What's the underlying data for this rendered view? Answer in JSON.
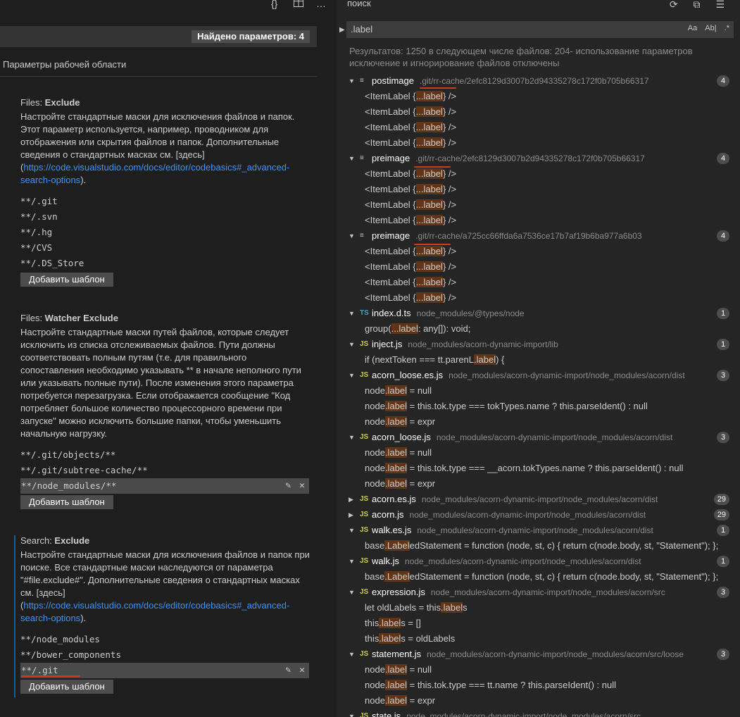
{
  "settings": {
    "topbar": {
      "braces_icon": "{}",
      "split_icon": "split-editor-icon",
      "more_icon": "…"
    },
    "found_badge": "Найдено параметров: 4",
    "section_title": "Параметры рабочей области",
    "files_exclude": {
      "category": "Files: ",
      "name": "Exclude",
      "desc_before": "Настройте стандартные маски для исключения файлов и папок. Этот параметр используется, например, проводником для отображения или скрытия файлов и папок. Дополнительные сведения о стандартных масках см. [здесь] (",
      "link": "https://code.visualstudio.com/docs/editor/codebasics#_advanced-search-options",
      "desc_after": ").",
      "patterns": [
        "**/.git",
        "**/.svn",
        "**/.hg",
        "**/CVS",
        "**/.DS_Store"
      ],
      "add_label": "Добавить шаблон"
    },
    "watcher_exclude": {
      "category": "Files: ",
      "name": "Watcher Exclude",
      "desc": "Настройте стандартные маски путей файлов, которые следует исключить из списка отслеживаемых файлов. Пути должны соответствовать полным путям (т.е. для правильного сопоставления необходимо указывать ** в начале неполного пути или указывать полные пути). После изменения этого параметра потребуется перезагрузка. Если отображается сообщение \"Код потребляет большое количество процессорного времени при запуске\" можно исключить большие папки, чтобы уменьшить начальную нагрузку.",
      "patterns": [
        "**/.git/objects/**",
        "**/.git/subtree-cache/**",
        "**/node_modules/**"
      ],
      "add_label": "Добавить шаблон"
    },
    "search_exclude": {
      "category": "Search: ",
      "name": "Exclude",
      "desc_before": "Настройте стандартные маски для исключения файлов и папок при поиске. Все стандартные маски наследуются от параметра \"#file.exclude#\". Дополнительные сведения о стандартных масках см. [здесь] (",
      "link": "https://code.visualstudio.com/docs/editor/codebasics#_advanced-search-options",
      "desc_after": ").",
      "patterns": [
        "**/node_modules",
        "**/bower_components",
        "**/.git"
      ],
      "add_label": "Добавить шаблон"
    },
    "edit_icon": "✎",
    "remove_icon": "✕"
  },
  "search": {
    "title": "поиск",
    "actions": {
      "refresh": "refresh-icon",
      "collapse": "collapse-all-icon",
      "clear": "clear-results-icon"
    },
    "query": ".label",
    "options": [
      "Aa",
      "Ab|",
      ".*"
    ],
    "summary": "Результатов: 1250 в следующем числе файлов: 204- использование параметров исключение и игнорирование файлов отключены",
    "results": [
      {
        "kind": "file",
        "expanded": true,
        "icon": "≡",
        "icon_type": "lines",
        "name": "postimage",
        "path": ".git/rr-cache/2efc8129d3007b2d94335278c172f0b705b66317",
        "count": "4",
        "matches": [
          [
            "<ItemLabel {",
            "...label",
            "} />"
          ],
          [
            "<ItemLabel {",
            "...label",
            "} />"
          ],
          [
            "<ItemLabel {",
            "...label",
            "} />"
          ],
          [
            "<ItemLabel {",
            "...label",
            "} />"
          ]
        ]
      },
      {
        "kind": "file",
        "expanded": true,
        "icon": "≡",
        "icon_type": "lines",
        "name": "preimage",
        "path": ".git/rr-cache/2efc8129d3007b2d94335278c172f0b705b66317",
        "count": "4",
        "matches": [
          [
            "<ItemLabel {",
            "...label",
            "} />"
          ],
          [
            "<ItemLabel {",
            "...label",
            "} />"
          ],
          [
            "<ItemLabel {",
            "...label",
            "} />"
          ],
          [
            "<ItemLabel {",
            "...label",
            "} />"
          ]
        ]
      },
      {
        "kind": "file",
        "expanded": true,
        "icon": "≡",
        "icon_type": "lines",
        "name": "preimage",
        "path": ".git/rr-cache/a725cc66ffda6a7536ce17b7af19b6ba977a6b03",
        "count": "4",
        "matches": [
          [
            "<ItemLabel {",
            "...label",
            "} />"
          ],
          [
            "<ItemLabel {",
            "...label",
            "} />"
          ],
          [
            "<ItemLabel {",
            "...label",
            "} />"
          ],
          [
            "<ItemLabel {",
            "...label",
            "} />"
          ]
        ]
      },
      {
        "kind": "file",
        "expanded": true,
        "icon": "TS",
        "icon_type": "ts",
        "name": "index.d.ts",
        "path": "node_modules/@types/node",
        "count": "1",
        "matches": [
          [
            "group(",
            "...label",
            ": any[]): void;"
          ]
        ]
      },
      {
        "kind": "file",
        "expanded": true,
        "icon": "JS",
        "icon_type": "js",
        "name": "inject.js",
        "path": "node_modules/acorn-dynamic-import/lib",
        "count": "1",
        "matches": [
          [
            "if (nextToken === tt.parenL",
            ".label",
            ") {"
          ]
        ]
      },
      {
        "kind": "file",
        "expanded": true,
        "icon": "JS",
        "icon_type": "js",
        "name": "acorn_loose.es.js",
        "path": "node_modules/acorn-dynamic-import/node_modules/acorn/dist",
        "count": "3",
        "matches": [
          [
            "node",
            ".label",
            " = null"
          ],
          [
            "node",
            ".label",
            " = this.tok.type === tokTypes.name ? this.parseIdent() : null"
          ],
          [
            "node",
            ".label",
            " = expr"
          ]
        ]
      },
      {
        "kind": "file",
        "expanded": true,
        "icon": "JS",
        "icon_type": "js",
        "name": "acorn_loose.js",
        "path": "node_modules/acorn-dynamic-import/node_modules/acorn/dist",
        "count": "3",
        "matches": [
          [
            "node",
            ".label",
            " = null"
          ],
          [
            "node",
            ".label",
            " = this.tok.type === __acorn.tokTypes.name ? this.parseIdent() : null"
          ],
          [
            "node",
            ".label",
            " = expr"
          ]
        ]
      },
      {
        "kind": "file",
        "expanded": false,
        "icon": "JS",
        "icon_type": "js",
        "name": "acorn.es.js",
        "path": "node_modules/acorn-dynamic-import/node_modules/acorn/dist",
        "count": "29",
        "matches": []
      },
      {
        "kind": "file",
        "expanded": false,
        "icon": "JS",
        "icon_type": "js",
        "name": "acorn.js",
        "path": "node_modules/acorn-dynamic-import/node_modules/acorn/dist",
        "count": "29",
        "matches": []
      },
      {
        "kind": "file",
        "expanded": true,
        "icon": "JS",
        "icon_type": "js",
        "name": "walk.es.js",
        "path": "node_modules/acorn-dynamic-import/node_modules/acorn/dist",
        "count": "1",
        "matches": [
          [
            "base",
            ".Label",
            "edStatement = function (node, st, c) { return c(node.body, st, \"Statement\"); };"
          ]
        ]
      },
      {
        "kind": "file",
        "expanded": true,
        "icon": "JS",
        "icon_type": "js",
        "name": "walk.js",
        "path": "node_modules/acorn-dynamic-import/node_modules/acorn/dist",
        "count": "1",
        "matches": [
          [
            "base",
            ".Label",
            "edStatement = function (node, st, c) { return c(node.body, st, \"Statement\"); };"
          ]
        ]
      },
      {
        "kind": "file",
        "expanded": true,
        "icon": "JS",
        "icon_type": "js",
        "name": "expression.js",
        "path": "node_modules/acorn-dynamic-import/node_modules/acorn/src",
        "count": "3",
        "matches": [
          [
            "let oldLabels = this",
            ".label",
            "s"
          ],
          [
            "this",
            ".label",
            "s = []"
          ],
          [
            "this",
            ".label",
            "s = oldLabels"
          ]
        ]
      },
      {
        "kind": "file",
        "expanded": true,
        "icon": "JS",
        "icon_type": "js",
        "name": "statement.js",
        "path": "node_modules/acorn-dynamic-import/node_modules/acorn/src/loose",
        "count": "3",
        "matches": [
          [
            "node",
            ".label",
            " = null"
          ],
          [
            "node",
            ".label",
            " = this.tok.type === tt.name ? this.parseIdent() : null"
          ],
          [
            "node",
            ".label",
            " = expr"
          ]
        ]
      },
      {
        "kind": "file",
        "expanded": true,
        "icon": "JS",
        "icon_type": "js",
        "name": "state.js",
        "path": "node_modules/acorn-dynamic-import/node_modules/acorn/src",
        "count": "",
        "matches": []
      }
    ]
  }
}
